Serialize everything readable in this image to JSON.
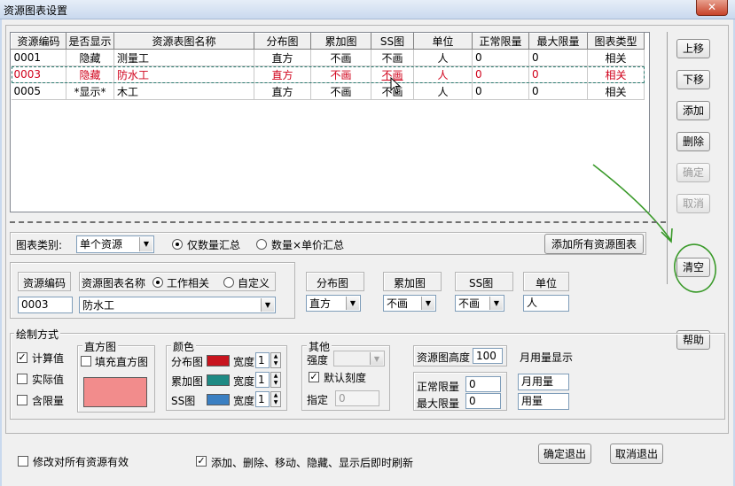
{
  "window": {
    "title": "资源图表设置",
    "close_glyph": "✕"
  },
  "grid": {
    "columns": [
      "资源编码",
      "是否显示",
      "资源表图名称",
      "分布图",
      "累加图",
      "SS图",
      "单位",
      "正常限量",
      "最大限量",
      "图表类型"
    ],
    "rows": [
      [
        "0001",
        "隐藏",
        "测量工",
        "直方",
        "不画",
        "不画",
        "人",
        "0",
        "0",
        "相关"
      ],
      [
        "0003",
        "隐藏",
        "防水工",
        "直方",
        "不画",
        "不画",
        "人",
        "0",
        "0",
        "相关"
      ],
      [
        "0005",
        "*显示*",
        "木工",
        "直方",
        "不画",
        "不画",
        "人",
        "0",
        "0",
        "相关"
      ]
    ],
    "selected_row_index": 1
  },
  "side_buttons": {
    "up": "上移",
    "down": "下移",
    "add": "添加",
    "delete": "删除",
    "confirm": "确定",
    "cancel": "取消",
    "clear": "清空",
    "help": "帮助"
  },
  "chart_type": {
    "label": "图表类别:",
    "value": "单个资源",
    "radio_qty": "仅数量汇总",
    "radio_qty_price": "数量×单价汇总",
    "radio_selected": "qty",
    "add_all_button": "添加所有资源图表"
  },
  "resource": {
    "code_label": "资源编码",
    "code_value": "0003",
    "name_label": "资源图表名称",
    "radio_work": "工作相关",
    "radio_custom": "自定义",
    "radio_selected": "work",
    "name_value": "防水工",
    "dist_label": "分布图",
    "dist_value": "直方",
    "accum_label": "累加图",
    "accum_value": "不画",
    "ss_label": "SS图",
    "ss_value": "不画",
    "unit_label": "单位",
    "unit_value": "人"
  },
  "draw": {
    "section_label": "绘制方式",
    "calc_value": "计算值",
    "calc_checked": true,
    "actual_value": "实际值",
    "actual_checked": false,
    "include_limit": "含限量",
    "include_checked": false,
    "histogram_label": "直方图",
    "fill_histogram": "填充直方图",
    "fill_checked": false,
    "histogram_color": "#f28c8c",
    "color_label": "颜色",
    "dist_label": "分布图",
    "dist_color": "#c8141e",
    "accum_label": "累加图",
    "accum_color": "#1e8a84",
    "ss_label": "SS图",
    "ss_color": "#3a7fc2",
    "width_label": "宽度",
    "dist_width": "1",
    "accum_width": "1",
    "ss_width": "1",
    "other_label": "其他",
    "strength_label": "强度",
    "strength_value": "",
    "default_scale": "默认刻度",
    "default_scale_checked": true,
    "specify_label": "指定",
    "specify_value": "0",
    "height_label": "资源图高度",
    "height_value": "100",
    "monthly_label": "月用量显示",
    "normal_limit_label": "正常限量",
    "normal_limit_value": "0",
    "max_limit_label": "最大限量",
    "max_limit_value": "0",
    "monthly_value": "月用量",
    "usage_value": "用量"
  },
  "footer": {
    "apply_all": "修改对所有资源有效",
    "apply_all_checked": false,
    "auto_refresh": "添加、删除、移动、隐藏、显示后即时刷新",
    "auto_refresh_checked": true,
    "ok_exit": "确定退出",
    "cancel_exit": "取消退出"
  },
  "colors": {
    "selected_text": "#d0021b",
    "annotation": "#3a9a2a"
  },
  "icons": {
    "dropdown": "dropdown-arrow-icon",
    "check": "checkmark-icon",
    "spin": "spin-arrows-icon",
    "cursor": "mouse-cursor-icon"
  }
}
